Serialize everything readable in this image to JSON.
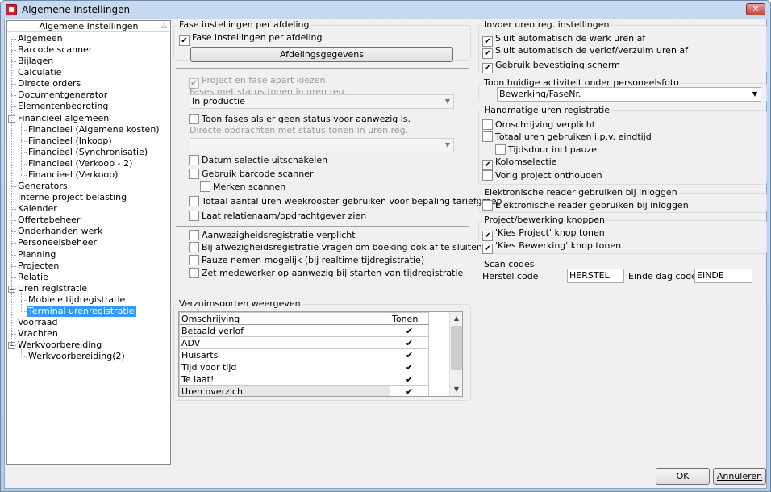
{
  "window": {
    "title": "Algemene Instellingen",
    "close": "✕"
  },
  "tree": {
    "header": "Algemene Instellingen",
    "items": [
      {
        "label": "Algemeen"
      },
      {
        "label": "Barcode scanner"
      },
      {
        "label": "Bijlagen"
      },
      {
        "label": "Calculatie"
      },
      {
        "label": "Directe orders"
      },
      {
        "label": "Documentgenerator"
      },
      {
        "label": "Elementenbegroting"
      },
      {
        "label": "Financieel algemeen",
        "expander": "−"
      },
      {
        "label": "Financieel (Algemene kosten)"
      },
      {
        "label": "Financieel (Inkoop)"
      },
      {
        "label": "Financieel (Synchronisatie)"
      },
      {
        "label": "Financieel (Verkoop - 2)"
      },
      {
        "label": "Financieel (Verkoop)"
      },
      {
        "label": "Generators"
      },
      {
        "label": "Interne project belasting"
      },
      {
        "label": "Kalender"
      },
      {
        "label": "Offertebeheer"
      },
      {
        "label": "Onderhanden werk"
      },
      {
        "label": "Personeelsbeheer"
      },
      {
        "label": "Planning"
      },
      {
        "label": "Projecten"
      },
      {
        "label": "Relatie"
      },
      {
        "label": "Uren registratie",
        "expander": "−"
      },
      {
        "label": "Mobiele tijdregistratie"
      },
      {
        "label": "Terminal urenregistratie"
      },
      {
        "label": "Voorraad"
      },
      {
        "label": "Vrachten"
      },
      {
        "label": "Werkvoorbereiding",
        "expander": "−"
      },
      {
        "label": "Werkvoorbereiding(2)"
      }
    ]
  },
  "fase": {
    "group_title": "Fase instellingen per afdeling",
    "per_afdeling": "Fase instellingen per afdeling",
    "afdelings_button": "Afdelingsgegevens",
    "apart": "Project en fase apart kiezen.",
    "fases_hint": "Fases met status tonen in uren reg.",
    "fases_combo": "In productie",
    "toon_fases": "Toon fases als er geen status voor aanwezig is.",
    "directe_hint": "Directe opdrachten met status tonen in uren reg.",
    "directe_combo": "",
    "datum": "Datum selectie uitschakelen",
    "barcode": "Gebruik barcode scanner",
    "merken": "Merken scannen",
    "totaal_uren": "Totaal aantal uren weekrooster gebruiken voor bepaling tariefgroep",
    "relatienaam": "Laat relatienaam/opdrachtgever zien",
    "aanwezig_verplicht": "Aanwezigheidsregistratie verplicht",
    "afwezig_vragen": "Bij afwezigheidsregistratie vragen om boeking ook af te sluiten",
    "pauze": "Pauze nemen mogelijk (bij realtime tijdregistratie)",
    "zet_aanwezig": "Zet medewerker op aanwezig bij starten van tijdregistratie"
  },
  "verzuim": {
    "group_title": "Verzuimsoorten weergeven",
    "col_omschrijving": "Omschrijving",
    "col_tonen": "Tonen",
    "rows": [
      {
        "name": "Betaald verlof",
        "check": "✔"
      },
      {
        "name": "ADV",
        "check": "✔"
      },
      {
        "name": "Huisarts",
        "check": "✔"
      },
      {
        "name": "Tijd voor tijd",
        "check": "✔"
      },
      {
        "name": "Te laat!",
        "check": "✔"
      },
      {
        "name": "Uren overzicht",
        "check": "✔"
      }
    ]
  },
  "invoer": {
    "group_title": "Invoer uren reg. instellingen",
    "sluit_werk": "Sluit automatisch de werk uren af",
    "sluit_verlof": "Sluit automatisch de verlof/verzuim uren af",
    "bevestiging": "Gebruik bevestiging scherm"
  },
  "activiteit": {
    "group_title": "Toon huidige activiteit onder personeelsfoto",
    "combo": "Bewerking/FaseNr."
  },
  "handmatig": {
    "group_title": "Handmatige uren registratie",
    "omschrijving": "Omschrijving verplicht",
    "totaal": "Totaal uren gebruiken i.p.v. eindtijd",
    "tijdsduur": "Tijdsduur incl pauze",
    "kolom": "Kolomselectie",
    "vorig": "Vorig project onthouden"
  },
  "reader": {
    "group_title": "Elektronische reader gebruiken bij inloggen",
    "cb": "Elektronische reader gebruiken bij inloggen"
  },
  "knoppen": {
    "group_title": "Project/bewerking knoppen",
    "kies_project": "'Kies Project' knop tonen",
    "kies_bewerking": "'Kies Bewerking' knop tonen"
  },
  "scan": {
    "group_title": "Scan codes",
    "herstel_label": "Herstel code",
    "herstel_value": "HERSTEL",
    "einde_label": "Einde dag code",
    "einde_value": "EINDE"
  },
  "buttons": {
    "ok": "OK",
    "annuleren": "Annuleren"
  },
  "glyphs": {
    "check": "✔",
    "arrow_down": "▼",
    "arrow_up": "▲",
    "sort": "△"
  }
}
